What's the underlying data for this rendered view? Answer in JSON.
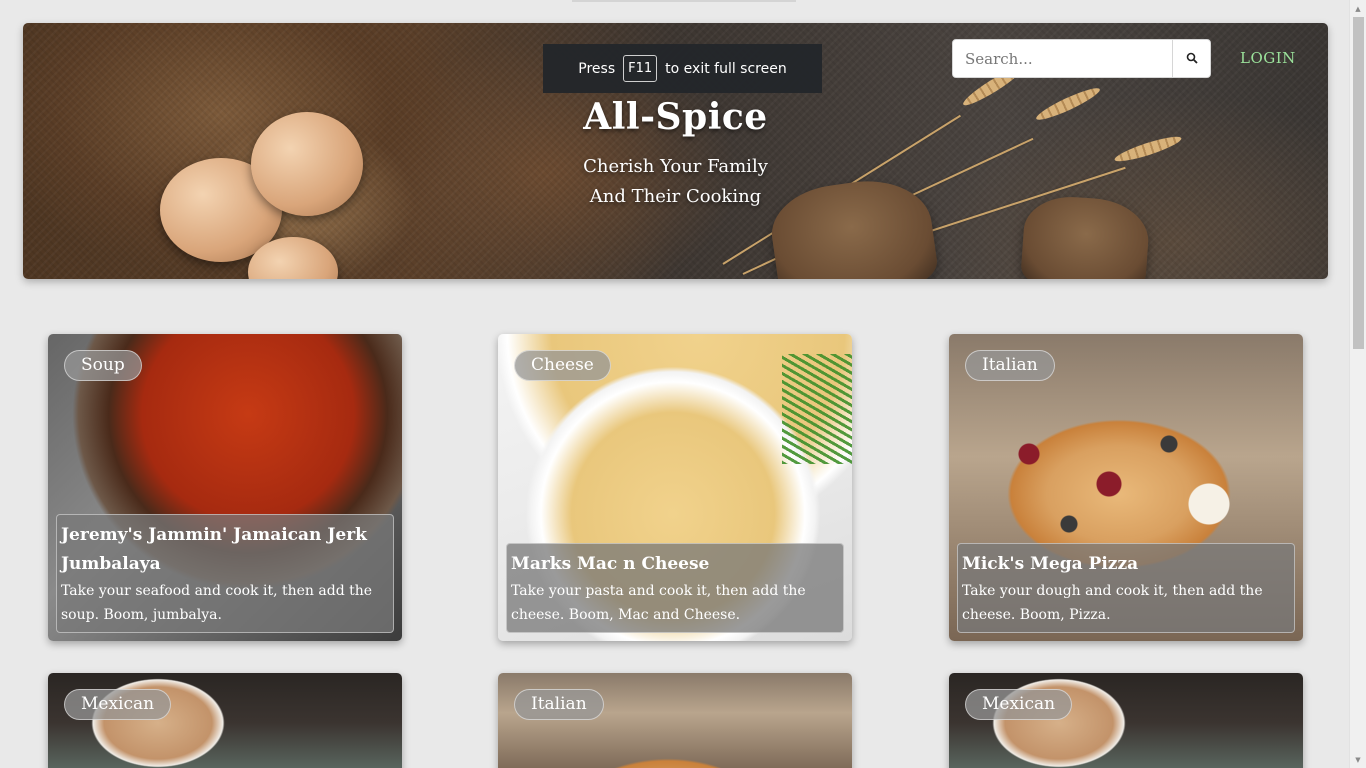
{
  "fullscreen": {
    "press": "Press",
    "key": "F11",
    "message": "to exit full screen"
  },
  "header": {
    "title": "All-Spice",
    "subtitle_line1": "Cherish Your Family",
    "subtitle_line2": "And Their Cooking",
    "search_placeholder": "Search...",
    "login_label": "LOGIN"
  },
  "recipes": [
    {
      "category": "Soup",
      "title": "Jeremy's Jammin' Jamaican Jerk Jumbalaya",
      "description": "Take your seafood and cook it, then add the soup. Boom, jumbalya."
    },
    {
      "category": "Cheese",
      "title": "Marks Mac n Cheese",
      "description": "Take your pasta and cook it, then add the cheese. Boom, Mac and Cheese."
    },
    {
      "category": "Italian",
      "title": "Mick's Mega Pizza",
      "description": "Take your dough and cook it, then add the cheese. Boom, Pizza."
    },
    {
      "category": "Mexican"
    },
    {
      "category": "Italian"
    },
    {
      "category": "Mexican"
    }
  ]
}
